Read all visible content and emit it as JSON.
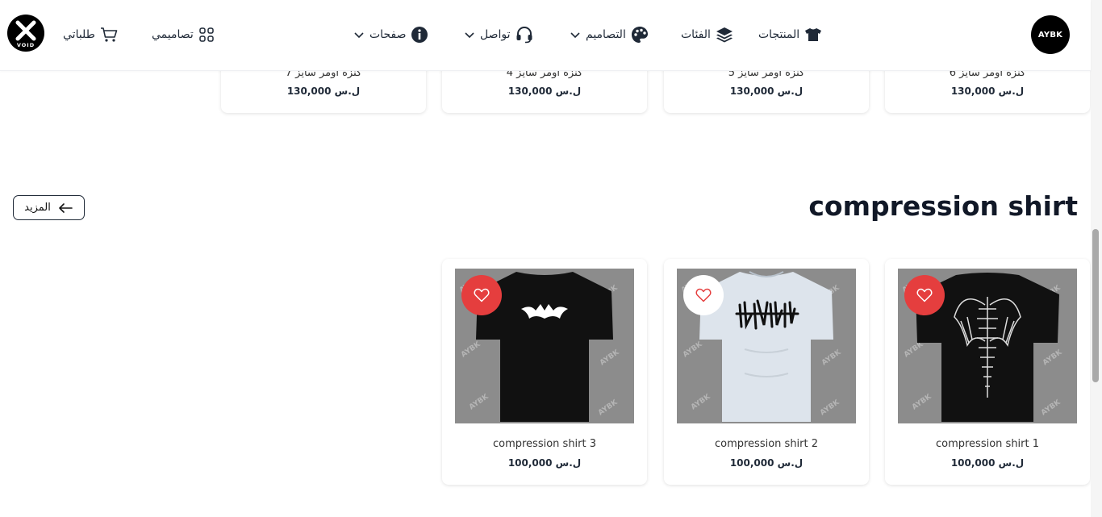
{
  "header": {
    "brand_logo_text": "AYBK",
    "void_logo_text": "VOID",
    "nav": {
      "products": "المنتجات",
      "categories": "الفئات",
      "designs": "التصاميم",
      "contact": "تواصل",
      "pages": "صفحات",
      "my_designs": "تصاميمي",
      "my_orders": "طلباتي"
    }
  },
  "top_products": [
    {
      "title": "كنزه اومر سايز 6",
      "price": "130,000 ل.س"
    },
    {
      "title": "كنزه اومر سايز 5",
      "price": "130,000 ل.س"
    },
    {
      "title": "كنزه اومر سايز 4",
      "price": "130,000 ل.س"
    },
    {
      "title": "كنزه اومر سايز 7",
      "price": "130,000 ل.س"
    }
  ],
  "section": {
    "title": "compression shirt",
    "more_label": "المزيد"
  },
  "products": [
    {
      "title": "compression shirt 1",
      "price": "100,000 ل.س",
      "favorite": true
    },
    {
      "title": "compression shirt 2",
      "price": "100,000 ل.س",
      "favorite": false
    },
    {
      "title": "compression shirt 3",
      "price": "100,000 ل.س",
      "favorite": true
    }
  ],
  "colors": {
    "accent_red": "#e53e3e",
    "dark": "#111827"
  }
}
